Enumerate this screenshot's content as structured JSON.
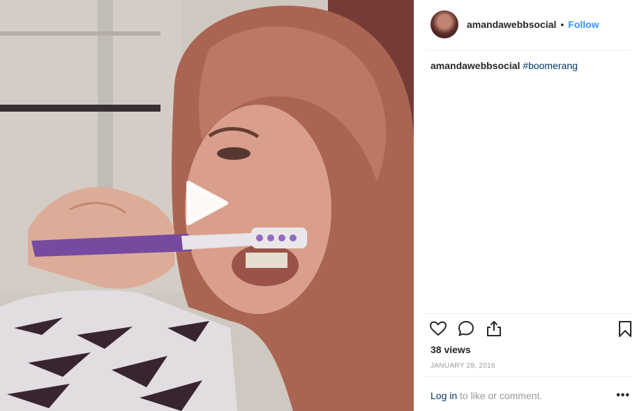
{
  "post": {
    "username": "amandawebbsocial",
    "separator": "•",
    "follow_label": "Follow",
    "caption": {
      "username": "amandawebbsocial",
      "hashtag": "#boomerang"
    },
    "views": "38 views",
    "date": "JANUARY 28, 2016",
    "login_link": "Log in",
    "login_suffix": " to like or comment.",
    "more_label": "•••"
  },
  "media": {
    "type": "video",
    "play_icon": "play-icon"
  },
  "icons": {
    "like": "heart-icon",
    "comment": "comment-bubble-icon",
    "share": "share-upload-icon",
    "save": "bookmark-icon",
    "more": "more-dots-icon"
  },
  "colors": {
    "link_blue": "#3897f0",
    "hashtag_navy": "#003569",
    "text_dark": "#262626",
    "text_muted": "#999999",
    "divider": "#efefef"
  }
}
